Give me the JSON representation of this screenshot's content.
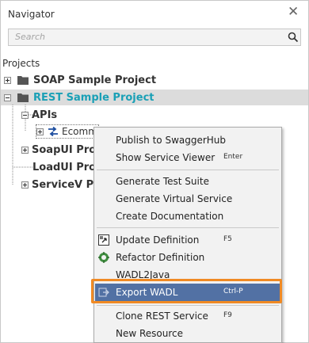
{
  "panel": {
    "title": "Navigator",
    "search_placeholder": "Search",
    "section_label": "Projects"
  },
  "tree": {
    "soap_sample": "SOAP Sample Project",
    "rest_sample": "REST Sample Project",
    "apis": "APIs",
    "api_item": "Ecomm",
    "soapui_pro": "SoapUI Pro",
    "loadui_pro": "LoadUI Pro",
    "servicev_pro": "ServiceV Pro"
  },
  "menu": {
    "items": [
      {
        "label": "Publish to SwaggerHub",
        "shortcut": ""
      },
      {
        "label": "Show Service Viewer",
        "shortcut": "Enter"
      },
      {
        "label": "Generate Test Suite",
        "shortcut": ""
      },
      {
        "label": "Generate Virtual Service",
        "shortcut": ""
      },
      {
        "label": "Create Documentation",
        "shortcut": ""
      },
      {
        "label": "Update Definition",
        "shortcut": "F5"
      },
      {
        "label": "Refactor Definition",
        "shortcut": ""
      },
      {
        "label": "WADL2Java",
        "shortcut": ""
      },
      {
        "label": "Export WADL",
        "shortcut": "Ctrl-P"
      },
      {
        "label": "Clone REST Service",
        "shortcut": "F9"
      },
      {
        "label": "New Resource",
        "shortcut": ""
      }
    ]
  },
  "colors": {
    "accent": "#1aa0b6",
    "menu_highlight": "#5271a4",
    "callout": "#f08a24",
    "selection": "#dcdcdc"
  }
}
